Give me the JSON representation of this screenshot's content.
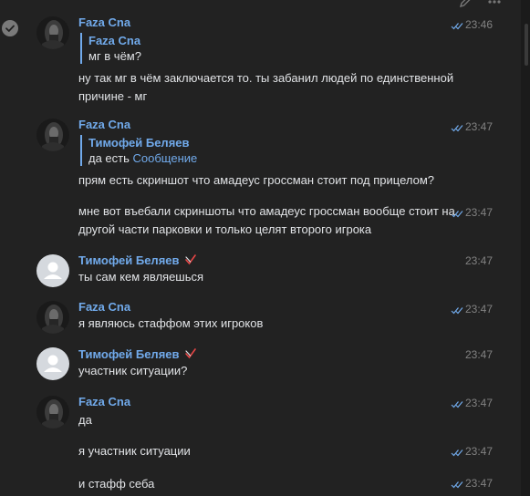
{
  "toolbar": {
    "edit_icon": "pencil-icon",
    "more_icon": "more-dots-icon"
  },
  "colors": {
    "background": "#222222",
    "author": "#71aaeb",
    "text": "#e1e3e6",
    "meta": "#828282",
    "read_check": "#71aaeb"
  },
  "messages": [
    {
      "author": "Faza Cna",
      "time": "23:46",
      "reply": {
        "author": "Faza Cna",
        "text": "мг в чём?"
      },
      "text": "ну так мг в чём заключается то. ты забанил людей по единственной причине - мг"
    },
    {
      "author": "Faza Cna",
      "time": "23:47",
      "reply": {
        "author": "Тимофей Беляев",
        "text": "да есть",
        "link": "Сообщение"
      },
      "text": "прям есть скриншот что амадеус гроссман стоит под прицелом?"
    },
    {
      "time": "23:47",
      "text": "мне вот въебали скриншоты что амадеус гроссман вообще стоит на другой части парковки и только целят второго игрока"
    },
    {
      "author": "Тимофей Беляев",
      "time": "23:47",
      "text": "ты сам кем являешься"
    },
    {
      "author": "Faza Cna",
      "time": "23:47",
      "text": "я являюсь стаффом этих игроков"
    },
    {
      "author": "Тимофей Беляев",
      "time": "23:47",
      "text": "участник ситуации?"
    },
    {
      "author": "Faza Cna",
      "time": "23:47",
      "text": "да"
    },
    {
      "time": "23:47",
      "text": "я участник ситуации"
    },
    {
      "time": "23:47",
      "text": "и стафф себа"
    }
  ]
}
